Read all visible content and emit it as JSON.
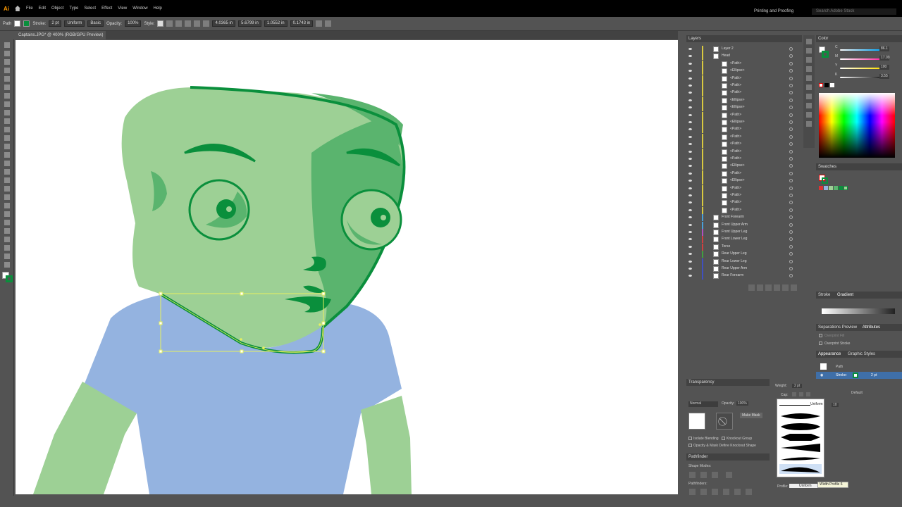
{
  "app": {
    "logo": "Ai"
  },
  "menu": [
    "File",
    "Edit",
    "Object",
    "Type",
    "Select",
    "Effect",
    "View",
    "Window",
    "Help"
  ],
  "workspace": "Printing and Proofing",
  "search_placeholder": "Search Adobe Stock",
  "control": {
    "selection": "Path",
    "stroke_label": "Stroke:",
    "stroke_weight": "2 pt",
    "profile": "Uniform",
    "brush": "Basic",
    "opacity_label": "Opacity:",
    "opacity": "100%",
    "style_label": "Style:",
    "x": "4.0365 in",
    "y": "5.6799 in",
    "w": "1.0552 in",
    "h": "0.1743 in"
  },
  "document_tab": "Captains.JPG* @ 400% (RGB/GPU Preview)",
  "layers": {
    "title": "Layers",
    "rows": [
      {
        "name": "Layer 2",
        "indent": 0,
        "bar": "#d8c840"
      },
      {
        "name": "Head",
        "indent": 0,
        "bar": "#d8c840"
      },
      {
        "name": "<Path>",
        "indent": 1,
        "bar": "#d8c840"
      },
      {
        "name": "<Ellipse>",
        "indent": 1,
        "bar": "#d8c840"
      },
      {
        "name": "<Path>",
        "indent": 1,
        "bar": "#d8c840"
      },
      {
        "name": "<Path>",
        "indent": 1,
        "bar": "#d8c840"
      },
      {
        "name": "<Path>",
        "indent": 1,
        "bar": "#d8c840"
      },
      {
        "name": "<Ellipse>",
        "indent": 1,
        "bar": "#d8c840"
      },
      {
        "name": "<Ellipse>",
        "indent": 1,
        "bar": "#d8c840"
      },
      {
        "name": "<Path>",
        "indent": 1,
        "bar": "#d8c840"
      },
      {
        "name": "<Ellipse>",
        "indent": 1,
        "bar": "#d8c840"
      },
      {
        "name": "<Path>",
        "indent": 1,
        "bar": "#d8c840"
      },
      {
        "name": "<Path>",
        "indent": 1,
        "bar": "#d8c840"
      },
      {
        "name": "<Path>",
        "indent": 1,
        "bar": "#d8c840"
      },
      {
        "name": "<Path>",
        "indent": 1,
        "bar": "#d8c840"
      },
      {
        "name": "<Path>",
        "indent": 1,
        "bar": "#d8c840"
      },
      {
        "name": "<Ellipse>",
        "indent": 1,
        "bar": "#d8c840"
      },
      {
        "name": "<Path>",
        "indent": 1,
        "bar": "#d8c840"
      },
      {
        "name": "<Ellipse>",
        "indent": 1,
        "bar": "#d8c840"
      },
      {
        "name": "<Path>",
        "indent": 1,
        "bar": "#d8c840"
      },
      {
        "name": "<Path>",
        "indent": 1,
        "bar": "#d8c840"
      },
      {
        "name": "<Path>",
        "indent": 1,
        "bar": "#d8c840"
      },
      {
        "name": "<Path>",
        "indent": 1,
        "bar": "#d8c840"
      },
      {
        "name": "Front Forearm",
        "indent": 0,
        "bar": "#4aa0d8"
      },
      {
        "name": "Front Upper Arm",
        "indent": 0,
        "bar": "#4aa0d8"
      },
      {
        "name": "Front Upper Leg",
        "indent": 0,
        "bar": "#b050c0"
      },
      {
        "name": "Front Lower Leg",
        "indent": 0,
        "bar": "#d04040"
      },
      {
        "name": "Torso",
        "indent": 0,
        "bar": "#d04040"
      },
      {
        "name": "Rear Upper Leg",
        "indent": 0,
        "bar": "#40a040"
      },
      {
        "name": "Rear Lower Leg",
        "indent": 0,
        "bar": "#4050c0"
      },
      {
        "name": "Rear Upper Arm",
        "indent": 0,
        "bar": "#4050c0"
      },
      {
        "name": "Rear Forearm",
        "indent": 0,
        "bar": "#4050c0"
      }
    ]
  },
  "color_panel": {
    "title": "Color",
    "channels": [
      {
        "label": "C",
        "value": "86.1",
        "color": "#00aaff"
      },
      {
        "label": "M",
        "value": "17.09",
        "color": "#ff2aa0"
      },
      {
        "label": "Y",
        "value": "100",
        "color": "#ffe000"
      },
      {
        "label": "K",
        "value": "3.55",
        "color": "#222222"
      }
    ]
  },
  "swatches": {
    "title": "Swatches"
  },
  "gradient": {
    "tab1": "Stroke",
    "tab2": "Gradient"
  },
  "separations": {
    "tab1": "Separations Preview",
    "tab2": "Attributes",
    "overprint_fill": "Overprint Fill",
    "overprint_stroke": "Overprint Stroke"
  },
  "appearance": {
    "tab1": "Appearance",
    "tab2": "Graphic Styles",
    "path_label": "Path",
    "stroke_label": "Stroke:",
    "stroke_value": "2 pt",
    "opacity_label": "Default"
  },
  "transparency": {
    "tab": "Transparency",
    "blend": "Normal",
    "opacity_label": "Opacity:",
    "opacity": "100%",
    "make_mask": "Make Mask",
    "isolate": "Isolate Blending",
    "knockout": "Knockout Group",
    "opacity_mask": "Opacity & Mask Define Knockout Shape",
    "pathfinder": "Pathfinder",
    "shape_modes": "Shape Modes:",
    "pathfinders": "Pathfinders:"
  },
  "stroke_panel": {
    "weight_label": "Weight:",
    "weight": "2 pt",
    "cap_label": "Cap:",
    "uniform": "Uniform",
    "limit": "10",
    "profile_label": "Profile:",
    "profile_value": "Uniform",
    "tooltip": "Width Profile 6"
  },
  "colors": {
    "face_light": "#9dd095",
    "face_mid": "#5ab46e",
    "face_dark": "#0a8f3c",
    "shirt": "#94b3e0",
    "selection": "#e6f060"
  }
}
